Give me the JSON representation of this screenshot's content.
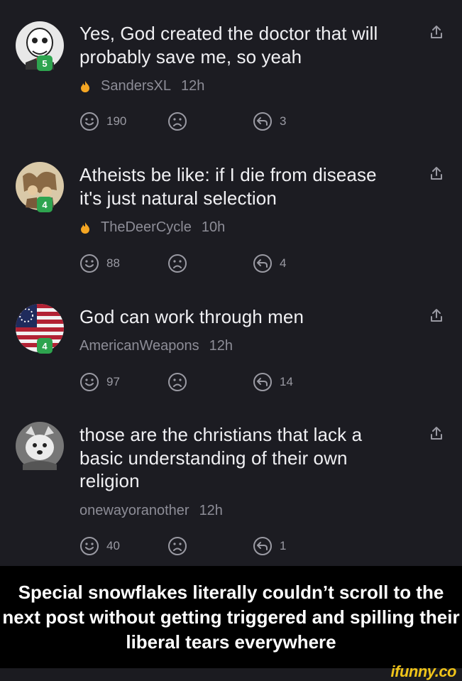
{
  "comments": [
    {
      "text": "Yes, God created the doctor that will probably save me, so yeah",
      "user": "SandersXL",
      "time": "12h",
      "level": "5",
      "has_flame": true,
      "likes": "190",
      "replies": "3"
    },
    {
      "text": "Atheists be like: if I die from disease it's just natural selection",
      "user": "TheDeerCycle",
      "time": "10h",
      "level": "4",
      "has_flame": true,
      "likes": "88",
      "replies": "4"
    },
    {
      "text": "God can work through men",
      "user": "AmericanWeapons",
      "time": "12h",
      "level": "4",
      "has_flame": false,
      "likes": "97",
      "replies": "14"
    },
    {
      "text": "those are the christians that lack a basic understanding of their own religion",
      "user": "onewayoranother",
      "time": "12h",
      "level": "",
      "has_flame": false,
      "likes": "40",
      "replies": "1"
    }
  ],
  "caption": "Special snowflakes literally couldn’t scroll to the next post without getting triggered and spilling their liberal tears everywhere",
  "brand": "ifunny.co",
  "colors": {
    "background": "#1c1c22",
    "caption_bg": "#000000",
    "badge": "#2ea44f",
    "flame": "#f5a623",
    "brand": "#f0c419",
    "meta": "#8d8d97"
  },
  "icons": {
    "like": "smile-icon",
    "dislike": "frown-icon",
    "reply": "reply-icon",
    "share": "share-icon",
    "flame": "flame-icon"
  }
}
